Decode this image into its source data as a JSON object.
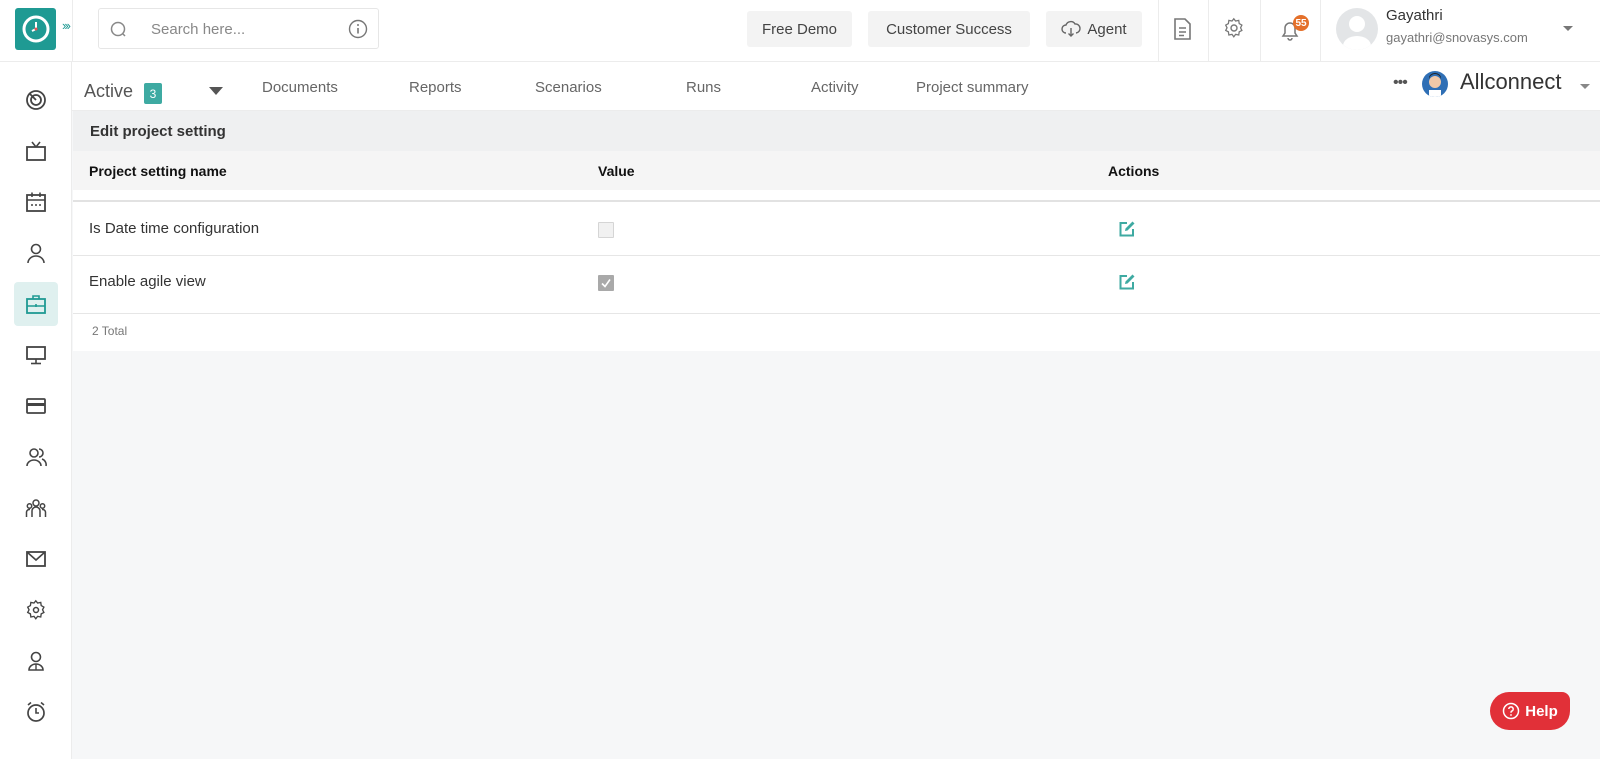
{
  "app": {
    "logo_icon": "clock-icon",
    "expand_icon": "triple-chevron-right-icon"
  },
  "search": {
    "placeholder": "Search here...",
    "value": ""
  },
  "header": {
    "buttons": [
      {
        "label": "Free Demo"
      },
      {
        "label": "Customer Success"
      },
      {
        "label": "Agent",
        "icon": "cloud-download-icon"
      }
    ],
    "icons": [
      "document-icon",
      "settings-icon",
      "bell-icon"
    ],
    "notification_count": "55",
    "user": {
      "name": "Gayathri",
      "email": "gayathri@snovasys.com"
    }
  },
  "sidebar": {
    "items": [
      {
        "icon": "dashboard-target-icon",
        "active": false
      },
      {
        "icon": "tv-icon",
        "active": false
      },
      {
        "icon": "calendar-icon",
        "active": false
      },
      {
        "icon": "user-icon",
        "active": false
      },
      {
        "icon": "briefcase-icon",
        "active": true
      },
      {
        "icon": "monitor-icon",
        "active": false
      },
      {
        "icon": "credit-card-icon",
        "active": false
      },
      {
        "icon": "users-icon",
        "active": false
      },
      {
        "icon": "team-icon",
        "active": false
      },
      {
        "icon": "mail-icon",
        "active": false
      },
      {
        "icon": "settings-icon",
        "active": false
      },
      {
        "icon": "employee-icon",
        "active": false
      },
      {
        "icon": "alarm-clock-icon",
        "active": false
      }
    ]
  },
  "subnav": {
    "active_label": "Active",
    "active_count": "3",
    "tabs": [
      "Documents",
      "Reports",
      "Scenarios",
      "Runs",
      "Activity",
      "Project summary"
    ],
    "more_label": "•••",
    "project_name": "Allconnect"
  },
  "panel": {
    "title": "Edit project setting",
    "columns": [
      "Project setting name",
      "Value",
      "Actions"
    ],
    "rows": [
      {
        "name": "Is Date time configuration",
        "value": false,
        "action": "edit-icon"
      },
      {
        "name": "Enable agile view",
        "value": true,
        "action": "edit-icon"
      }
    ],
    "total_label": "2 Total"
  },
  "help": {
    "label": "Help",
    "color": "#e13038"
  },
  "colors": {
    "brand": "#1f9a93",
    "badge": "#e4702a",
    "count_badge": "#3eaaa2"
  }
}
